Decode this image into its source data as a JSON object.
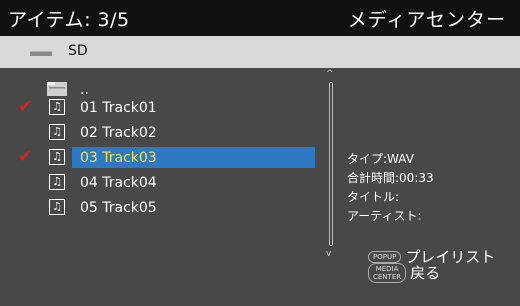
{
  "header": {
    "item_counter": "アイテム: 3/5",
    "title": "メディアセンター"
  },
  "path": {
    "icon": "drive-icon",
    "label": "SD"
  },
  "list": {
    "parent": "..",
    "items": [
      {
        "label": "01 Track01",
        "checked": true,
        "icon": "music-note-icon"
      },
      {
        "label": "02 Track02",
        "checked": false,
        "icon": "music-note-icon"
      },
      {
        "label": "03 Track03",
        "checked": true,
        "selected": true,
        "icon": "music-note-icon"
      },
      {
        "label": "04 Track04",
        "checked": false,
        "icon": "music-note-icon"
      },
      {
        "label": "05 Track05",
        "checked": false,
        "icon": "music-note-icon"
      }
    ]
  },
  "info": {
    "type": "タイプ:WAV",
    "total_time": "合計時間:00:33",
    "title": "タイトル:",
    "artist": "アーティスト:"
  },
  "hints": {
    "popup_badge": "POPUP",
    "popup_text": "プレイリスト",
    "media_badge_line1": "MEDIA",
    "media_badge_line2": "CENTER",
    "media_text": "戻る"
  },
  "colors": {
    "selection": "#2f78c4",
    "selected_text": "#f2e94a",
    "check": "#e02020"
  }
}
